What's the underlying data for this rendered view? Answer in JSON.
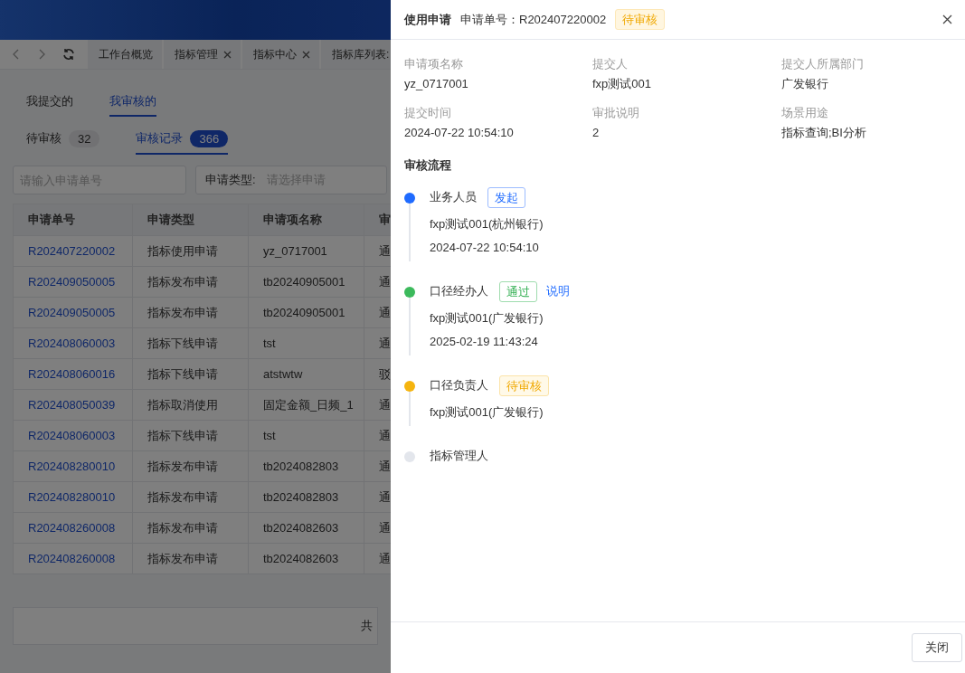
{
  "nav_tabs": [
    {
      "label": "工作台概览",
      "closable": false,
      "selected": false
    },
    {
      "label": "指标管理",
      "closable": true,
      "selected": false
    },
    {
      "label": "指标中心",
      "closable": true,
      "selected": false
    },
    {
      "label": "指标库列表:",
      "closable": false,
      "selected": false
    }
  ],
  "view_tabs": [
    {
      "label": "我提交的",
      "selected": false
    },
    {
      "label": "我审核的",
      "selected": true
    }
  ],
  "sub_tabs": [
    {
      "label": "待审核",
      "count": "32",
      "selected": false
    },
    {
      "label": "审核记录",
      "count": "366",
      "selected": true
    }
  ],
  "filters": {
    "search": {
      "placeholder": "请输入申请单号"
    },
    "type_select": {
      "label": "申请类型:",
      "placeholder": "请选择申请"
    }
  },
  "table": {
    "columns": [
      "申请单号",
      "申请类型",
      "申请项名称",
      "审"
    ],
    "rows": [
      [
        "R202407220002",
        "指标使用申请",
        "yz_0717001",
        "通"
      ],
      [
        "R202409050005",
        "指标发布申请",
        "tb20240905001",
        "通"
      ],
      [
        "R202409050005",
        "指标发布申请",
        "tb20240905001",
        "通"
      ],
      [
        "R202408060003",
        "指标下线申请",
        "tst",
        "通"
      ],
      [
        "R202408060016",
        "指标下线申请",
        "atstwtw",
        "驳"
      ],
      [
        "R202408050039",
        "指标取消使用",
        "固定金额_日频_1",
        "通"
      ],
      [
        "R202408060003",
        "指标下线申请",
        "tst",
        "通"
      ],
      [
        "R202408280010",
        "指标发布申请",
        "tb2024082803",
        "通"
      ],
      [
        "R202408280010",
        "指标发布申请",
        "tb2024082803",
        "通"
      ],
      [
        "R202408260008",
        "指标发布申请",
        "tb2024082603",
        "通"
      ],
      [
        "R202408260008",
        "指标发布申请",
        "tb2024082603",
        "通"
      ]
    ]
  },
  "pagination": {
    "text": "共"
  },
  "drawer": {
    "title": "使用申请",
    "number": "申请单号：R202407220002",
    "status": {
      "text": "待审核",
      "kind": "pending"
    },
    "fields": [
      {
        "label": "申请项名称",
        "value": "yz_0717001"
      },
      {
        "label": "提交人",
        "value": "fxp测试001"
      },
      {
        "label": "提交人所属部门",
        "value": "广发银行"
      },
      {
        "label": "提交时间",
        "value": "2024-07-22 10:54:10"
      },
      {
        "label": "审批说明",
        "value": "2"
      },
      {
        "label": "场景用途",
        "value": "指标查询;BI分析"
      }
    ],
    "flow_title": "审核流程",
    "steps": [
      {
        "role": "业务人员",
        "color": "#1f6bff",
        "tag": {
          "text": "发起",
          "kind": "start"
        },
        "details": [
          "fxp测试001(杭州银行)",
          "2024-07-22 10:54:10"
        ]
      },
      {
        "role": "口径经办人",
        "color": "#3cba5c",
        "tag": {
          "text": "通过",
          "kind": "pass"
        },
        "link": "说明",
        "details": [
          "fxp测试001(广发银行)",
          "2025-02-19 11:43:24"
        ]
      },
      {
        "role": "口径负责人",
        "color": "#f5b40f",
        "tag": {
          "text": "待审核",
          "kind": "pending"
        },
        "details": [
          "fxp测试001(广发银行)"
        ]
      },
      {
        "role": "指标管理人",
        "color": "#e3e6ec"
      }
    ],
    "close_button": "关闭"
  }
}
